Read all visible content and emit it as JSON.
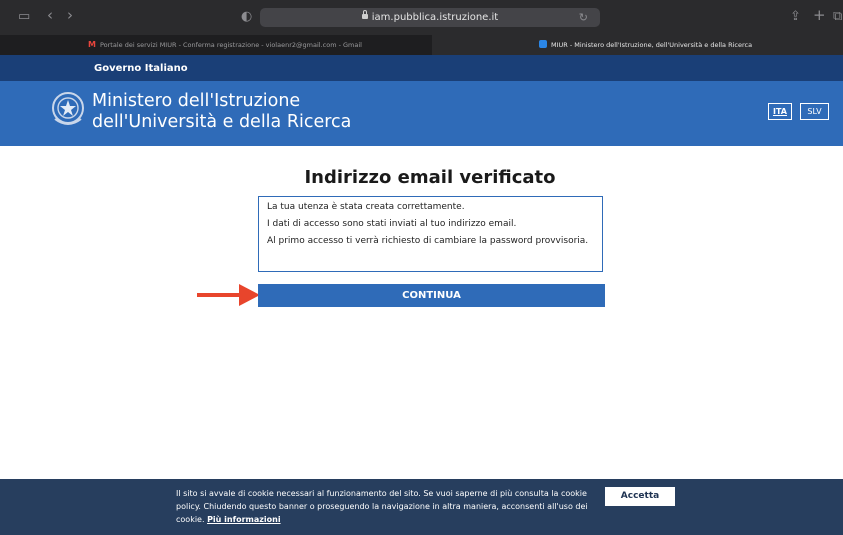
{
  "browser": {
    "address": "iam.pubblica.istruzione.it",
    "tabs": [
      {
        "label": "Portale dei servizi MIUR - Conferma registrazione - violaenr2@gmail.com - Gmail",
        "active": false,
        "favicon": "gmail-icon"
      },
      {
        "label": "MIUR - Ministero dell'Istruzione, dell'Università e della Ricerca",
        "active": true,
        "favicon": "miur-icon"
      }
    ],
    "icons": {
      "sidebar": "▭",
      "back": "‹",
      "forward": "›",
      "shield": "◐",
      "reload": "↻",
      "share": "⇪",
      "new_tab": "+",
      "tabs": "⧉",
      "gmail": "M"
    }
  },
  "header": {
    "gov_label": "Governo Italiano",
    "ministry_line1": "Ministero dell'Istruzione",
    "ministry_line2": "dell'Università e della Ricerca",
    "languages": [
      "ITA",
      "SLV"
    ],
    "active_language": "ITA"
  },
  "main": {
    "title": "Indirizzo email verificato",
    "messages": [
      "La tua utenza è stata creata correttamente.",
      "I dati di accesso sono stati inviati al tuo indirizzo email.",
      "Al primo accesso ti verrà richiesto di cambiare la password provvisoria."
    ],
    "continue_label": "CONTINUA"
  },
  "cookie_banner": {
    "text": "Il sito si avvale di cookie necessari al funzionamento del sito. Se vuoi saperne di più consulta la cookie policy. Chiudendo questo banner o proseguendo la navigazione in altra maniera, acconsenti all'uso dei cookie.",
    "link_label": "Più informazioni",
    "accept_label": "Accetta"
  },
  "colors": {
    "gov_bar": "#1a3f77",
    "ministry_header": "#2f6bb8",
    "button": "#2f6bb8",
    "cookie_banner": "#273e5e",
    "arrow": "#e8452c"
  }
}
